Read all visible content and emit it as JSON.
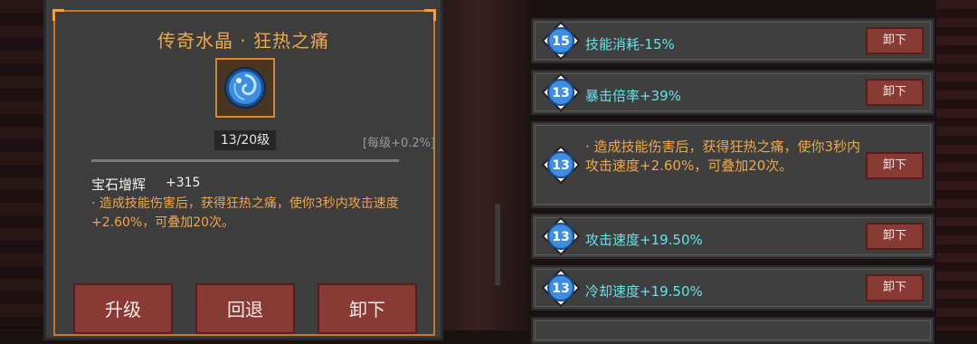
{
  "gem_detail": {
    "title": "传奇水晶 · 狂热之痛",
    "level": "13/20级",
    "per_level": "[每级+0.2%]",
    "bonus_label": "宝石增辉",
    "bonus_value": "+315",
    "effect": "· 造成技能伤害后，获得狂热之痛，使你3秒内攻击速度+2.60%，可叠加20次。",
    "buttons": {
      "upgrade": "升级",
      "revert": "回退",
      "unequip": "卸下"
    },
    "colors": {
      "title": "#f0a64a",
      "frame": "#c9772a",
      "button": "#8a3a34"
    }
  },
  "affixes": [
    {
      "level": "15",
      "text": "技能消耗-15%",
      "button": "卸下"
    },
    {
      "level": "13",
      "text": "暴击倍率+39%",
      "button": "卸下"
    },
    {
      "level": "13",
      "text": "· 造成技能伤害后，获得狂热之痛，使你3秒内攻击速度+2.60%，可叠加20次。",
      "button": "卸下"
    },
    {
      "level": "13",
      "text": "攻击速度+19.50%",
      "button": "卸下"
    },
    {
      "level": "13",
      "text": "冷却速度+19.50%",
      "button": "卸下"
    },
    {
      "level": "",
      "text": "",
      "button": ""
    }
  ],
  "colors": {
    "affix_text": "#63e3e8",
    "effect_text": "#f0a64a",
    "icon": "#3d8ee0"
  }
}
